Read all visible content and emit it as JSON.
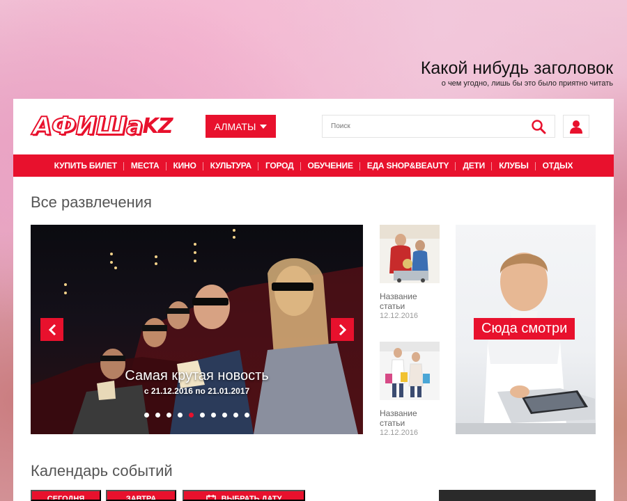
{
  "hero": {
    "title": "Какой нибудь заголовок",
    "subtitle": "о чем угодно, лишь бы это было приятно читать"
  },
  "header": {
    "logo_main": "АФИШа",
    "logo_suffix": "KZ",
    "city_label": "АЛМАТЫ",
    "search_placeholder": "Поиск"
  },
  "nav": {
    "items": [
      {
        "label": "КУПИТЬ БИЛЕТ"
      },
      {
        "label": "МЕСТА"
      },
      {
        "label": "КИНО"
      },
      {
        "label": "КУЛЬТУРА"
      },
      {
        "label": "ГОРОД"
      },
      {
        "label": "ОБУЧЕНИЕ"
      },
      {
        "label": "ЕДА SHOP&BEAUTY"
      },
      {
        "label": "ДЕТИ"
      },
      {
        "label": "КЛУБЫ"
      },
      {
        "label": "ОТДЫХ"
      }
    ]
  },
  "main": {
    "section_title": "Все развлечения",
    "slider": {
      "title": "Самая крутая новость",
      "date": "с 21.12.2016 по 21.01.2017",
      "slide_count": 10,
      "active_index": 4
    },
    "articles": [
      {
        "title_line1": "Название",
        "title_line2": "статьи",
        "date": "12.12.2016"
      },
      {
        "title_line1": "Название",
        "title_line2": "статьи",
        "date": "12.12.2016"
      }
    ],
    "promo": {
      "label": "Сюда смотри"
    }
  },
  "calendar": {
    "section_title": "Календарь событий",
    "today_label": "СЕГОДНЯ",
    "tomorrow_label": "ЗАВТРА",
    "pick_date_label": "ВЫБРАТЬ ДАТУ"
  },
  "colors": {
    "accent": "#e8112d",
    "text_gray": "#555555",
    "meta_gray": "#999999"
  }
}
